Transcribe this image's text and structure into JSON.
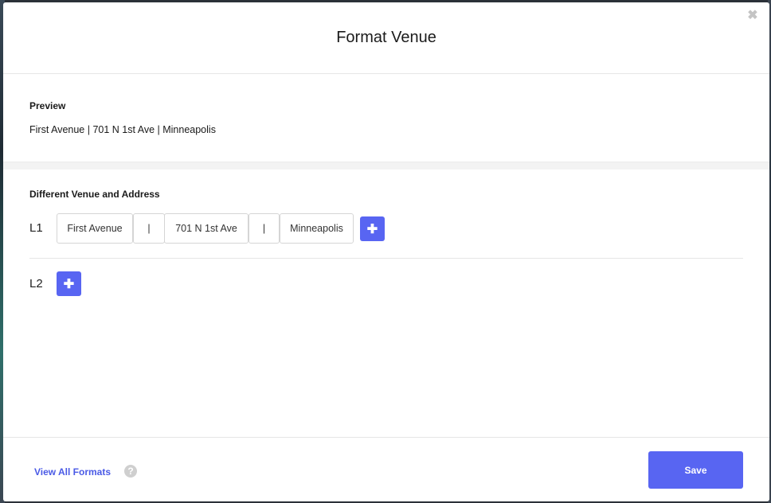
{
  "modal": {
    "title": "Format Venue",
    "close_icon": "close-icon"
  },
  "preview": {
    "label": "Preview",
    "text": "First Avenue | 701 N 1st Ave | Minneapolis"
  },
  "format": {
    "section_title": "Different Venue and Address",
    "lines": [
      {
        "label": "L1",
        "chips": [
          "First Avenue",
          "|",
          "701 N 1st Ave",
          "|",
          "Minneapolis"
        ],
        "add_icon": "plus-icon"
      },
      {
        "label": "L2",
        "chips": [],
        "add_icon": "plus-icon"
      }
    ]
  },
  "footer": {
    "view_all_label": "View All Formats",
    "help_icon": "question-icon",
    "save_label": "Save"
  },
  "colors": {
    "accent": "#5865f2",
    "link": "#4a5ae6"
  }
}
